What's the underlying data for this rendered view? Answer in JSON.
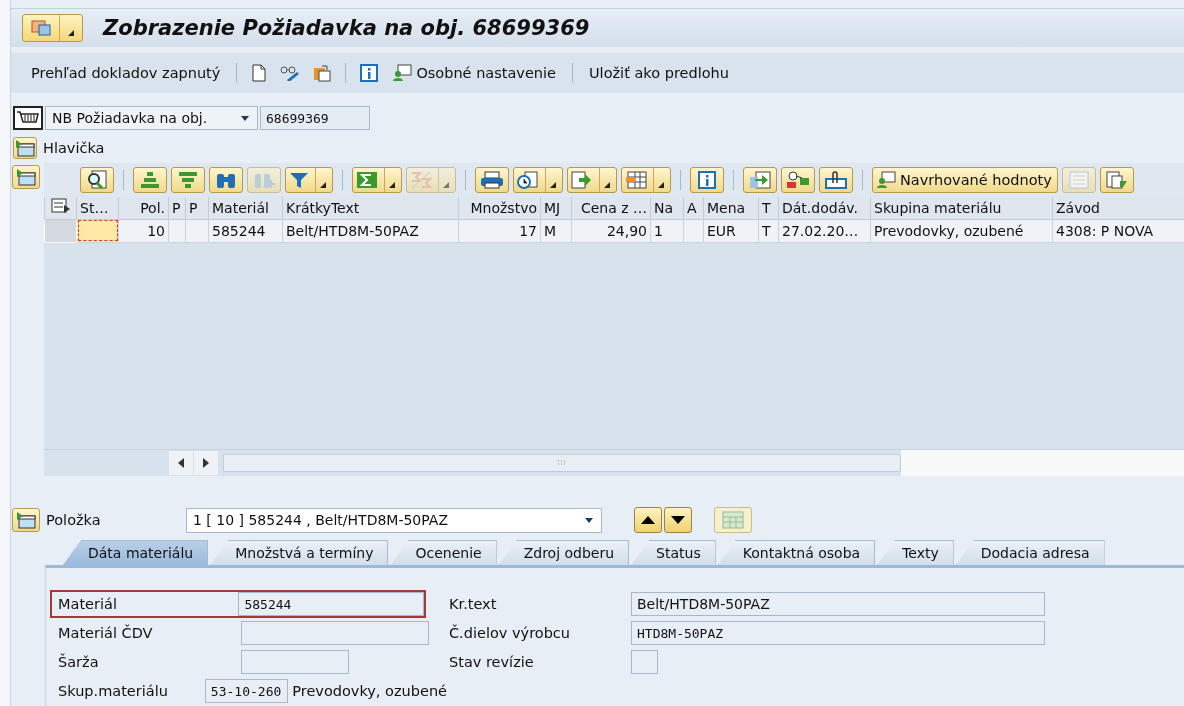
{
  "window": {
    "title": "Zobrazenie Požiadavka na obj. 68699369"
  },
  "toolbar": [
    {
      "kind": "text",
      "label": "Prehľad dokladov zapnutý"
    },
    {
      "kind": "separator"
    },
    {
      "kind": "icon"
    },
    {
      "kind": "icon"
    },
    {
      "kind": "icon"
    },
    {
      "kind": "separator"
    },
    {
      "kind": "icon"
    },
    {
      "kind": "icon_text",
      "label": "Osobné nastavenie"
    },
    {
      "kind": "separator"
    },
    {
      "kind": "text",
      "label": "Uložiť ako predlohu"
    }
  ],
  "document": {
    "type": "NB Požiadavka na obj.",
    "number": "68699369"
  },
  "header_section": {
    "label": "Hlavička"
  },
  "grid": {
    "toolbar": [
      {
        "kind": "button",
        "disabled": false,
        "menu": false
      },
      {
        "kind": "separator"
      },
      {
        "kind": "button",
        "disabled": false,
        "menu": false
      },
      {
        "kind": "button",
        "disabled": false,
        "menu": false
      },
      {
        "kind": "button",
        "disabled": false,
        "menu": false
      },
      {
        "kind": "button",
        "disabled": true,
        "menu": false
      },
      {
        "kind": "button",
        "disabled": false,
        "menu": true
      },
      {
        "kind": "separator"
      },
      {
        "kind": "button",
        "disabled": false,
        "menu": true
      },
      {
        "kind": "button",
        "disabled": true,
        "menu": true
      },
      {
        "kind": "separator"
      },
      {
        "kind": "button",
        "disabled": false,
        "menu": false
      },
      {
        "kind": "button",
        "disabled": false,
        "menu": true
      },
      {
        "kind": "button",
        "disabled": false,
        "menu": true
      },
      {
        "kind": "button",
        "disabled": false,
        "menu": true
      },
      {
        "kind": "separator"
      },
      {
        "kind": "button",
        "disabled": false,
        "menu": false
      },
      {
        "kind": "separator"
      },
      {
        "kind": "button",
        "disabled": false,
        "menu": false
      },
      {
        "kind": "button",
        "disabled": false,
        "menu": false
      },
      {
        "kind": "button",
        "disabled": false,
        "menu": false
      },
      {
        "kind": "separator"
      },
      {
        "kind": "text_button",
        "label": "Navrhované hodnoty",
        "disabled": false,
        "menu": false
      },
      {
        "kind": "button",
        "disabled": true,
        "menu": false
      },
      {
        "kind": "button",
        "disabled": false,
        "menu": false
      }
    ],
    "columns": [
      {
        "label": "St…"
      },
      {
        "label": "Pol."
      },
      {
        "label": "P"
      },
      {
        "label": "P"
      },
      {
        "label": "Materiál"
      },
      {
        "label": "KrátkyText"
      },
      {
        "label": "Množstvo"
      },
      {
        "label": "MJ"
      },
      {
        "label": "Cena z …"
      },
      {
        "label": "Na"
      },
      {
        "label": "A"
      },
      {
        "label": "Mena"
      },
      {
        "label": "T"
      },
      {
        "label": "Dát.dodáv."
      },
      {
        "label": "Skupina materiálu"
      },
      {
        "label": "Závod"
      }
    ],
    "rows": [
      {
        "selected": false,
        "cells": [
          {
            "focused": true
          },
          {
            "text": "10",
            "focused": false
          },
          {
            "focused": false
          },
          {
            "focused": false
          },
          {
            "text": "585244",
            "focused": false
          },
          {
            "text": "Belt/HTD8M-50PAZ",
            "focused": false
          },
          {
            "text": "17",
            "focused": false
          },
          {
            "text": "M",
            "focused": false
          },
          {
            "text": "24,90",
            "focused": false
          },
          {
            "text": "1",
            "focused": false
          },
          {
            "focused": false
          },
          {
            "text": "EUR",
            "focused": false
          },
          {
            "text": "T",
            "focused": false
          },
          {
            "text": "27.02.20…",
            "focused": false
          },
          {
            "text": "Prevodovky, ozubené",
            "focused": false
          },
          {
            "text": "4308: P NOVA",
            "focused": false
          }
        ]
      }
    ]
  },
  "item": {
    "label": "Položka",
    "value": "1 [ 10 ] 585244 , Belt/HTD8M-50PAZ"
  },
  "tabs": [
    {
      "label": "Dáta materiálu",
      "selected": true
    },
    {
      "label": "Množstvá a termíny",
      "selected": false
    },
    {
      "label": "Ocenenie",
      "selected": false
    },
    {
      "label": "Zdroj odberu",
      "selected": false
    },
    {
      "label": "Status",
      "selected": false
    },
    {
      "label": "Kontaktná osoba",
      "selected": false
    },
    {
      "label": "Texty",
      "selected": false
    },
    {
      "label": "Dodacia adresa",
      "selected": false
    }
  ],
  "fields": [
    {
      "label": "Materiál",
      "value": "585244",
      "highlighted": true
    },
    {
      "label": "Kr.text",
      "value": "Belt/HTD8M-50PAZ",
      "highlighted": false
    },
    {
      "label": "Materiál ČDV",
      "highlighted": false
    },
    {
      "label": "Č.dielov výrobcu",
      "value": "HTD8M-50PAZ",
      "highlighted": false
    },
    {
      "label": "Šarža",
      "highlighted": false
    },
    {
      "label": "Stav revízie",
      "highlighted": false
    },
    {
      "label": "Skup.materiálu",
      "value": "53-10-260",
      "description": "Prevodovky, ozubené",
      "highlighted": false
    }
  ]
}
